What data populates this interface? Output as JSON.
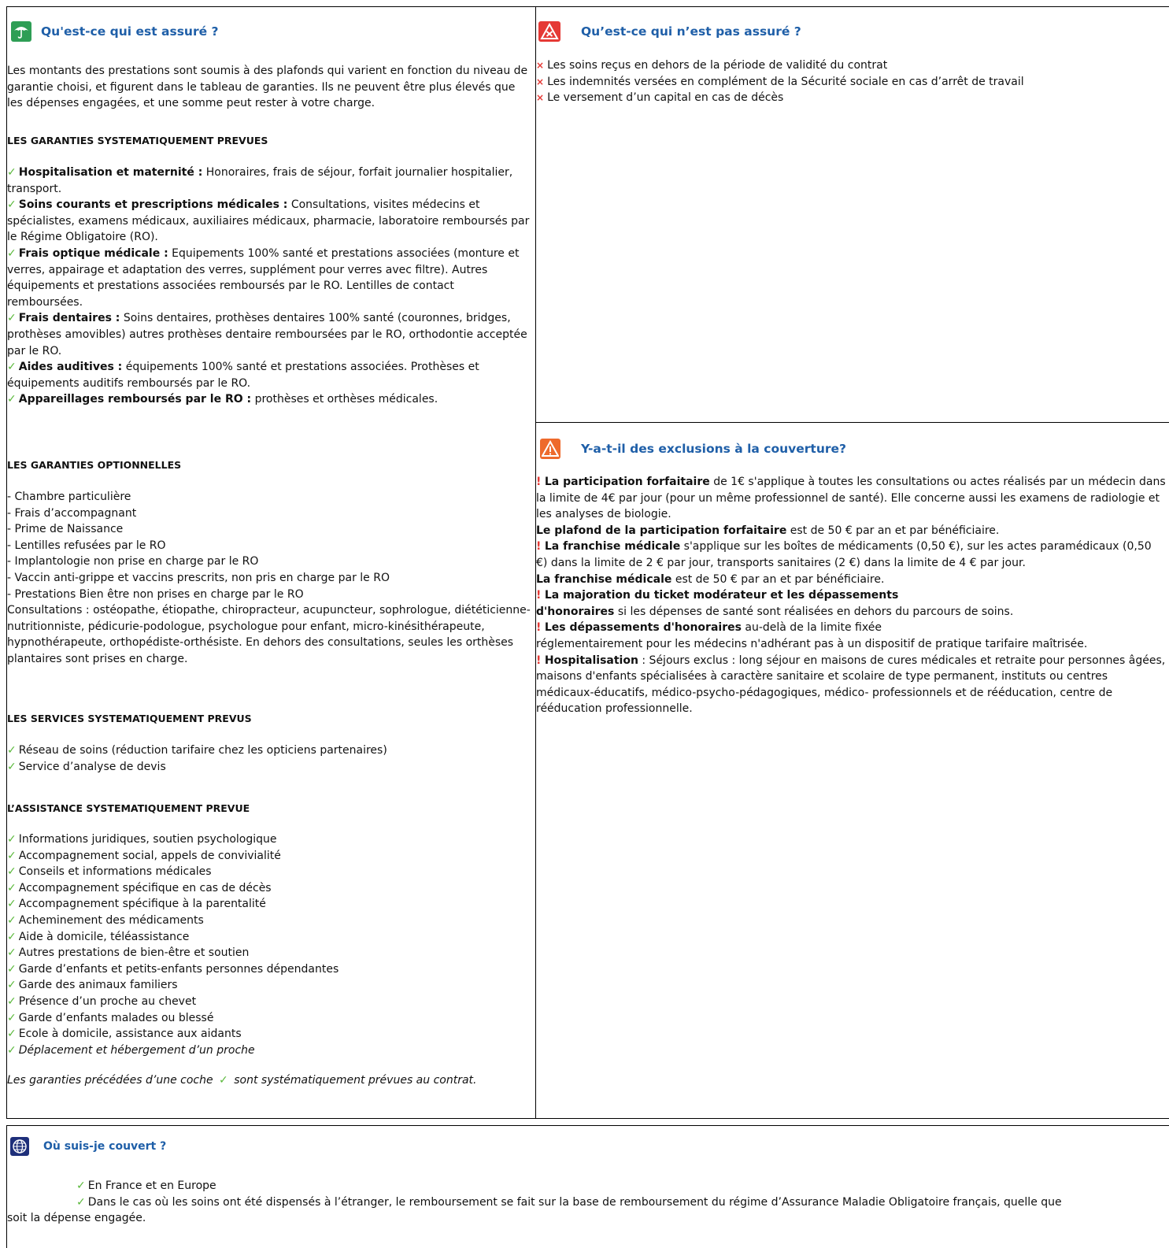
{
  "assure": {
    "title": "Qu'est-ce qui est assuré ?",
    "intro": "Les montants des prestations sont soumis à des plafonds qui varient en fonction du niveau de garantie choisi, et figurent dans le tableau de garanties. Ils ne peuvent être plus élevés que les dépenses engagées, et une somme peut rester à votre charge.",
    "systematic_heading": "LES GARANTIES SYSTEMATIQUEMENT PREVUES",
    "systematic_items": [
      {
        "bold": "Hospitalisation et maternité :",
        "text": " Honoraires, frais de séjour, forfait journalier hospitalier, transport."
      },
      {
        "bold": "Soins courants et prescriptions médicales :",
        "text": " Consultations, visites médecins et spécialistes, examens médicaux, auxiliaires médicaux, pharmacie, laboratoire remboursés par le Régime Obligatoire (RO)."
      },
      {
        "bold": "Frais optique médicale :",
        "text": " Equipements 100% santé et prestations associées (monture et verres, appairage et adaptation des verres, supplément pour verres avec filtre). Autres équipements et prestations associées remboursés par le RO. Lentilles de contact remboursées."
      },
      {
        "bold": "Frais dentaires :",
        "text": " Soins dentaires, prothèses dentaires 100% santé (couronnes, bridges, prothèses amovibles) autres prothèses dentaire remboursées par le RO, orthodontie acceptée par le RO."
      },
      {
        "bold": "Aides auditives :",
        "text": " équipements 100% santé et prestations associées. Prothèses et équipements auditifs remboursés par le RO."
      },
      {
        "bold": "Appareillages remboursés par le RO :",
        "text": " prothèses et orthèses médicales."
      }
    ],
    "optional_heading": "LES GARANTIES OPTIONNELLES",
    "optional_items": [
      "- Chambre particulière",
      "- Frais d’accompagnant",
      "- Prime de Naissance",
      "- Lentilles refusées par le RO",
      "- Implantologie non prise en charge par le RO",
      "- Vaccin anti-grippe et vaccins prescrits, non pris en charge par le RO",
      "- Prestations Bien être non prises en charge par le RO"
    ],
    "optional_note": "Consultations : ostéopathe, étiopathe, chiropracteur, acupuncteur, sophrologue, diététicienne-nutritionniste, pédicurie-podologue, psychologue pour enfant, micro-kinésithérapeute, hypnothérapeute, orthopédiste-orthésiste. En dehors des consultations, seules les orthèses plantaires sont prises en charge.",
    "services_heading": "LES SERVICES SYSTEMATIQUEMENT PREVUS",
    "services_items": [
      "Réseau de soins (réduction tarifaire chez les opticiens partenaires)",
      "Service d’analyse de devis"
    ],
    "assistance_heading": "L’ASSISTANCE SYSTEMATIQUEMENT PREVUE",
    "assistance_items": [
      "Informations juridiques, soutien psychologique",
      "Accompagnement social, appels de convivialité",
      "Conseils et informations médicales",
      "Accompagnement spécifique en cas de décès",
      "Accompagnement spécifique à la parentalité",
      "Acheminement des médicaments",
      "Aide à domicile, téléassistance",
      "Autres prestations de bien-être et soutien",
      "Garde d’enfants et petits-enfants personnes dépendantes",
      "Garde des animaux familiers",
      "Présence d’un proche au chevet",
      "Garde d’enfants malades ou blessé",
      "Ecole à domicile, assistance aux aidants",
      "Déplacement et hébergement d’un proche"
    ],
    "footnote_a": "Les garanties précédées d’une coche",
    "footnote_b": "sont systématiquement prévues au contrat."
  },
  "non_assure": {
    "title": "Qu’est-ce qui n’est pas assuré ?",
    "items": [
      "Les soins reçus en dehors de la période de validité du contrat",
      "Les indemnités versées  en  complément de la Sécurité sociale  en  cas d’arrêt de travail",
      "Le versement d’un capital en cas de décès"
    ]
  },
  "exclusions": {
    "title": "Y-a-t-il des exclusions à la couverture?",
    "p1_bold": "La participation forfaitaire",
    "p1_text": " de 1€ s'applique à toutes les consultations ou actes réalisés par un médecin dans la limite de 4€ par jour (pour un même professionnel de santé). Elle concerne aussi les examens de radiologie et les analyses de biologie.",
    "p2_bold": "Le plafond de la participation forfaitaire",
    "p2_text": " est de 50 € par an et par bénéficiaire.",
    "p3_bold": "La franchise médicale",
    "p3_text": " s'applique sur les boîtes de médicaments (0,50 €), sur les actes paramédicaux (0,50 €) dans la limite de 2 € par jour, transports sanitaires (2 €) dans la limite de 4 € par jour.",
    "p4_bold": "La franchise médicale",
    "p4_text": " est de 50 € par an et par bénéficiaire.",
    "p5_bold_a": "La majoration du ticket modérateur et les dépassements",
    "p5_bold_b": "d'honoraires",
    "p5_text": " si les dépenses de santé sont réalisées en dehors du parcours de soins.",
    "p6_bold": "Les dépassements d'honoraires",
    "p6_text": " au-delà de la limite fixée",
    "p6_text2": "réglementairement pour les médecins n'adhérant pas à un dispositif de pratique tarifaire maîtrisée.",
    "p7_bold": "Hospitalisation",
    "p7_text": " : Séjours exclus : long séjour en maisons de cures médicales et retraite pour personnes âgées, maisons d'enfants spécialisées à caractère sanitaire et scolaire de type permanent, instituts ou centres médicaux-éducatifs, médico-psycho-pédagogiques, médico- professionnels et de rééducation, centre de rééducation professionnelle."
  },
  "couvert": {
    "title": "Où suis-je couvert ?",
    "item1": "En France et en Europe",
    "item2_a": "Dans le cas où les soins ont été dispensés à l’étranger, le remboursement se fait sur la base de remboursement du régime d’Assurance Maladie Obligatoire français, quelle que",
    "item2_b": "soit la dépense engagée."
  },
  "symbols": {
    "check": "✓",
    "cross": "×",
    "bang": "!"
  },
  "colors": {
    "title_blue": "#1f5fa8",
    "check_green": "#5ab83b",
    "alert_red": "#e53935",
    "umbrella_green": "#2e9e55",
    "warning_orange": "#ee6a2c",
    "globe_navy": "#1e2f7a"
  },
  "icons": [
    "umbrella-icon",
    "cross-warning-icon",
    "warning-triangle-icon",
    "globe-icon"
  ]
}
